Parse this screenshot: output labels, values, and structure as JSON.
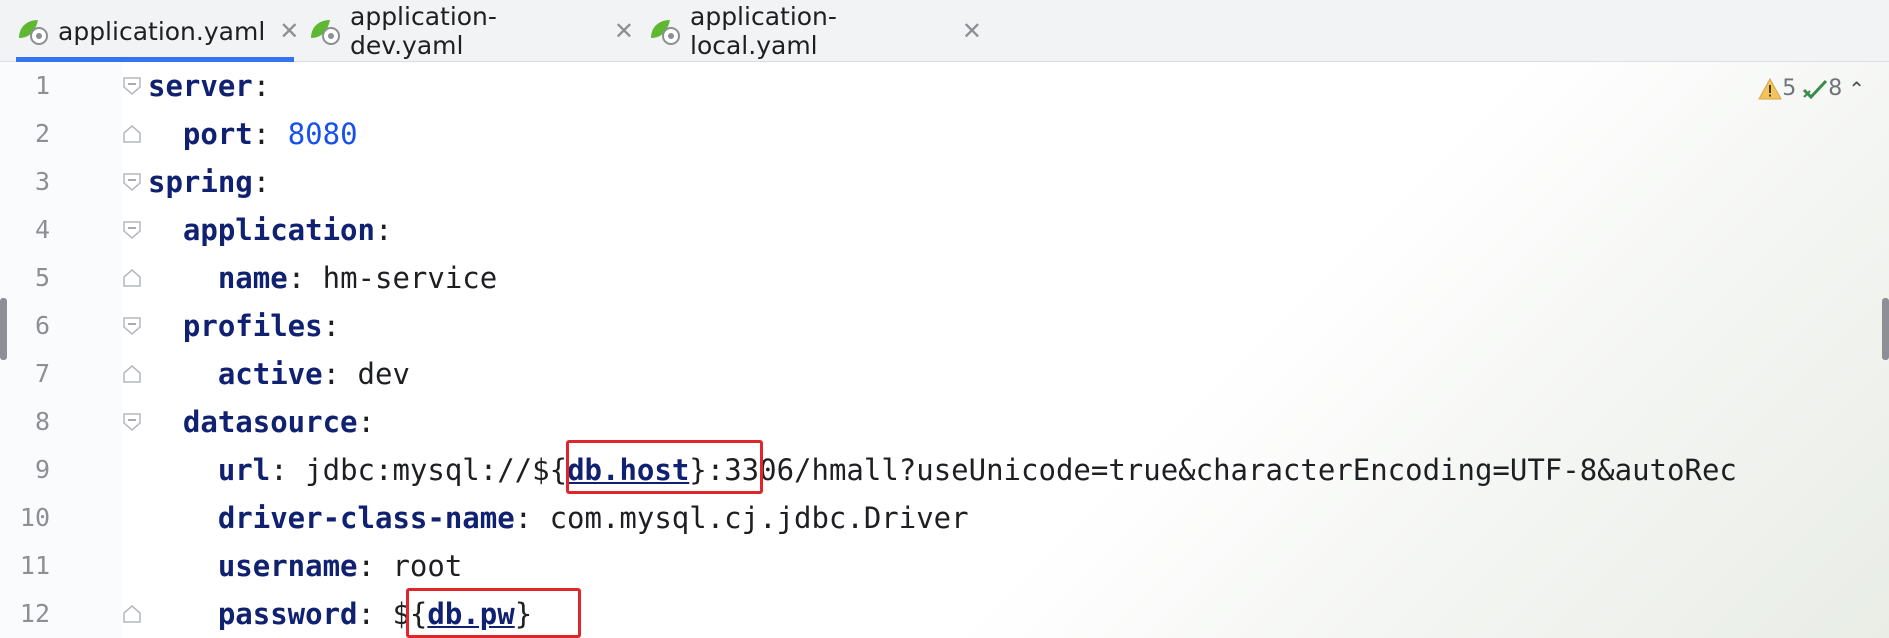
{
  "tabs": [
    {
      "label": "application.yaml",
      "active": true,
      "icon": "spring-yaml-icon"
    },
    {
      "label": "application-dev.yaml",
      "active": false,
      "icon": "spring-yaml-icon"
    },
    {
      "label": "application-local.yaml",
      "active": false,
      "icon": "spring-yaml-icon"
    }
  ],
  "inspection": {
    "warnings": "5",
    "weak_warnings": "8"
  },
  "code": {
    "l1": {
      "no": "1",
      "key": "server",
      "colon": ":"
    },
    "l2": {
      "no": "2",
      "key": "port",
      "colon": ": ",
      "value": "8080"
    },
    "l3": {
      "no": "3",
      "key": "spring",
      "colon": ":"
    },
    "l4": {
      "no": "4",
      "key": "application",
      "colon": ":"
    },
    "l5": {
      "no": "5",
      "key": "name",
      "colon": ": ",
      "value": "hm-service"
    },
    "l6": {
      "no": "6",
      "key": "profiles",
      "colon": ":"
    },
    "l7": {
      "no": "7",
      "key": "active",
      "colon": ": ",
      "value": "dev"
    },
    "l8": {
      "no": "8",
      "key": "datasource",
      "colon": ":"
    },
    "l9": {
      "no": "9",
      "key": "url",
      "colon": ": ",
      "prefix": "jdbc:mysql://",
      "ref_open": "${",
      "ref": "db.host",
      "ref_close": "}",
      "suffix": ":3306/hmall?useUnicode=true&characterEncoding=UTF-8&autoRec"
    },
    "l10": {
      "no": "10",
      "key": "driver-class-name",
      "colon": ": ",
      "value": "com.mysql.cj.jdbc.Driver"
    },
    "l11": {
      "no": "11",
      "key": "username",
      "colon": ": ",
      "value": "root"
    },
    "l12": {
      "no": "12",
      "key": "password",
      "colon": ": ",
      "ref_open": "${",
      "ref": "db.pw",
      "ref_close": "}"
    }
  },
  "colors": {
    "accent": "#3574f0",
    "highlight_box": "#e0252c",
    "key": "#0f2170",
    "number": "#1750eb"
  }
}
